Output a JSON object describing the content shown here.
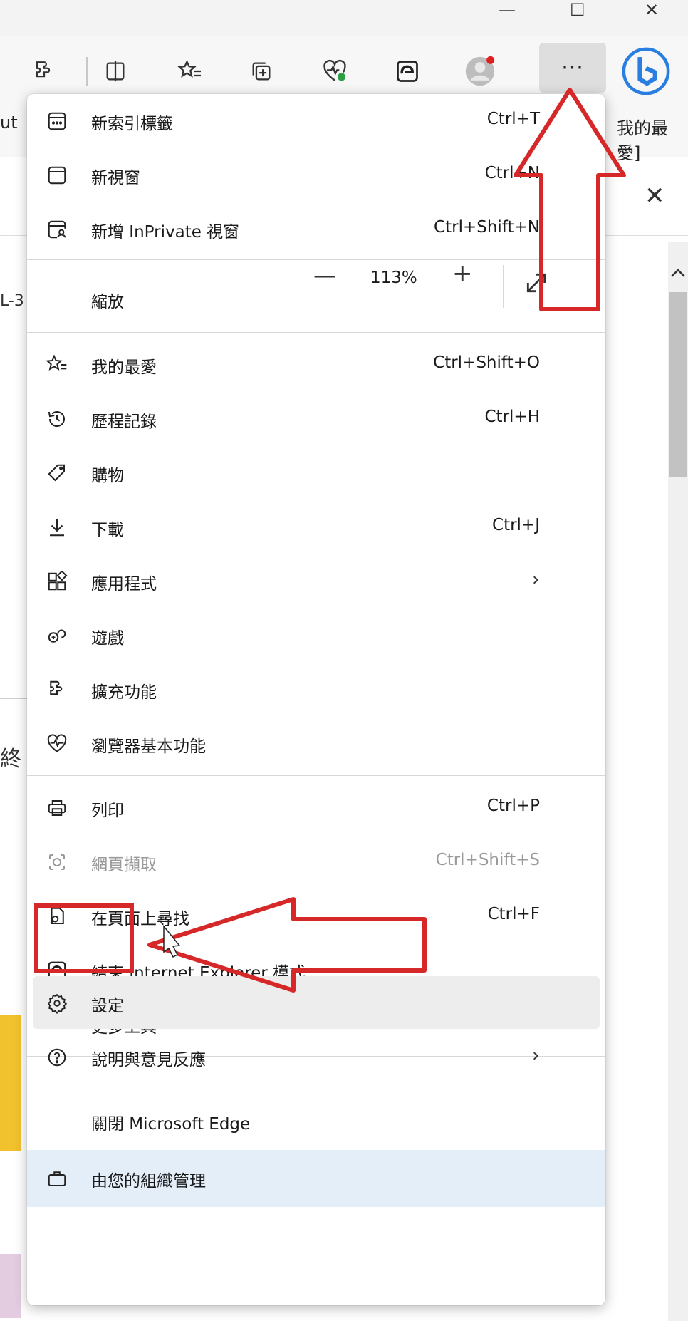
{
  "window": {
    "minimize": "—",
    "maximize": "☐",
    "close": "✕"
  },
  "toolbar": {
    "icons": [
      "extensions-icon",
      "split-screen-icon",
      "favorites-icon",
      "collections-icon",
      "browser-essentials-icon",
      "ie-mode-icon",
      "profile-avatar",
      "more-options-icon",
      "bing-icon"
    ],
    "more_label": "···"
  },
  "background": {
    "fav_left": "ut",
    "fav_right": "我的最愛]",
    "infobar_close": "✕",
    "frag1": "L-3",
    "frag2": "終"
  },
  "menu": {
    "new_tab": {
      "label": "新索引標籤",
      "shortcut": "Ctrl+T"
    },
    "new_window": {
      "label": "新視窗",
      "shortcut": "Ctrl+N"
    },
    "new_inprivate": {
      "label": "新增 InPrivate 視窗",
      "shortcut": "Ctrl+Shift+N"
    },
    "zoom": {
      "label": "縮放",
      "minus": "—",
      "value": "113%",
      "plus": "+"
    },
    "favorites": {
      "label": "我的最愛",
      "shortcut": "Ctrl+Shift+O"
    },
    "history": {
      "label": "歷程記錄",
      "shortcut": "Ctrl+H"
    },
    "shopping": {
      "label": "購物"
    },
    "downloads": {
      "label": "下載",
      "shortcut": "Ctrl+J"
    },
    "apps": {
      "label": "應用程式",
      "chevron": "›"
    },
    "games": {
      "label": "遊戲"
    },
    "extensions": {
      "label": "擴充功能"
    },
    "essentials": {
      "label": "瀏覽器基本功能"
    },
    "print": {
      "label": "列印",
      "shortcut": "Ctrl+P"
    },
    "web_capture": {
      "label": "網頁擷取",
      "shortcut": "Ctrl+Shift+S"
    },
    "find": {
      "label": "在頁面上尋找",
      "shortcut": "Ctrl+F"
    },
    "exit_ie": {
      "label": "結束 Internet Explorer 模式"
    },
    "more_tools": {
      "label": "更多工具",
      "chevron": "›"
    },
    "settings": {
      "label": "設定"
    },
    "help": {
      "label": "說明與意見反應",
      "chevron": "›"
    },
    "close_edge": {
      "label": "關閉 Microsoft Edge"
    },
    "managed": {
      "label": "由您的組織管理"
    }
  },
  "colors": {
    "annotation_red": "#d62828",
    "bing_blue": "#2a7de1",
    "managed_bg": "#e4eef8"
  }
}
